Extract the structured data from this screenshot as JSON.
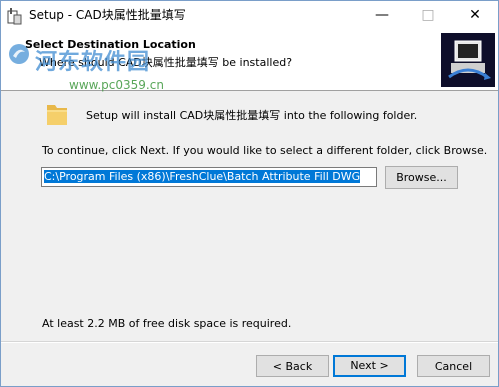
{
  "window": {
    "title": "Setup - CAD块属性批量填写",
    "minimize_glyph": "—",
    "maximize_glyph": "□",
    "close_glyph": "✕"
  },
  "header": {
    "title": "Select Destination Location",
    "subtitle": "Where should CAD块属性批量填写 be installed?"
  },
  "watermark": {
    "site_name": "河东软件园",
    "site_url": "www.pc0359.cn"
  },
  "body": {
    "install_text": "Setup will install CAD块属性批量填写 into the following folder.",
    "continue_text": "To continue, click Next. If you would like to select a different folder, click Browse.",
    "path_value": "C:\\Program Files (x86)\\FreshClue\\Batch Attribute Fill DWG",
    "browse_label": "Browse...",
    "disk_space_text": "At least 2.2 MB of free disk space is required."
  },
  "footer": {
    "back_label": "< Back",
    "next_label": "Next >",
    "cancel_label": "Cancel"
  },
  "colors": {
    "accent": "#0078d7",
    "selection": "#0078d7",
    "header_image_bg": "#0e0e2a"
  }
}
